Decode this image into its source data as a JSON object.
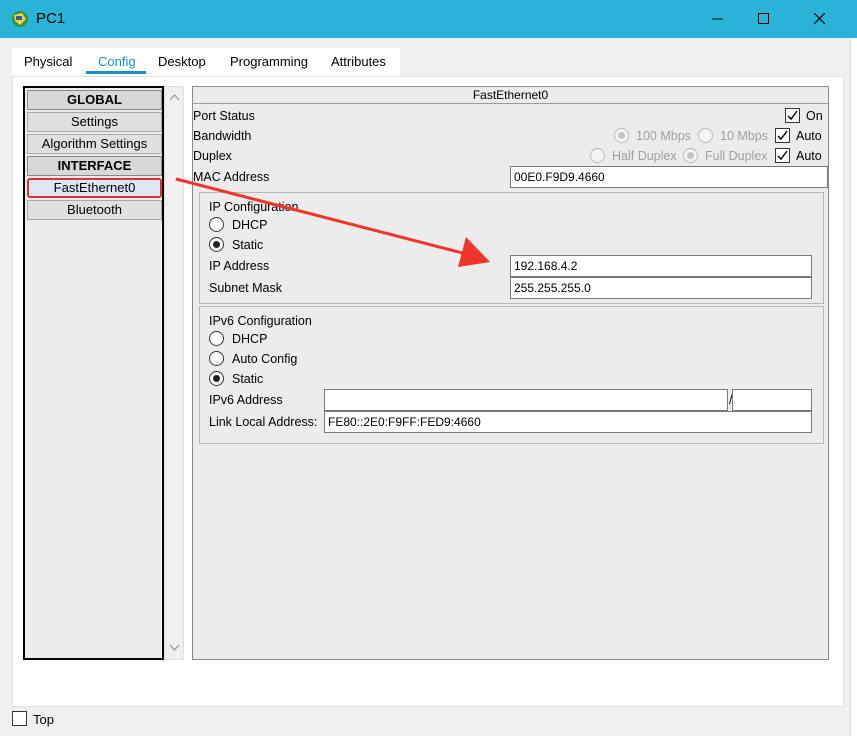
{
  "window": {
    "title": "PC1"
  },
  "tabs": [
    "Physical",
    "Config",
    "Desktop",
    "Programming",
    "Attributes"
  ],
  "active_tab": "Config",
  "left_nav": {
    "items": [
      {
        "label": "GLOBAL",
        "type": "header"
      },
      {
        "label": "Settings",
        "type": "item"
      },
      {
        "label": "Algorithm Settings",
        "type": "item"
      },
      {
        "label": "INTERFACE",
        "type": "header"
      },
      {
        "label": "FastEthernet0",
        "type": "item",
        "selected": true
      },
      {
        "label": "Bluetooth",
        "type": "item"
      }
    ]
  },
  "panel": {
    "title": "FastEthernet0",
    "port_status": {
      "label": "Port Status",
      "on_label": "On",
      "on_checked": true
    },
    "bandwidth": {
      "label": "Bandwidth",
      "opt1": "100 Mbps",
      "opt2": "10 Mbps",
      "auto_label": "Auto",
      "auto_checked": true
    },
    "duplex": {
      "label": "Duplex",
      "opt1": "Half Duplex",
      "opt2": "Full Duplex",
      "auto_label": "Auto",
      "auto_checked": true
    },
    "mac": {
      "label": "MAC Address",
      "value": "00E0.F9D9.4660"
    },
    "ip_config": {
      "title": "IP Configuration",
      "dhcp_label": "DHCP",
      "static_label": "Static",
      "selected": "Static",
      "ip_label": "IP Address",
      "ip_value": "192.168.4.2",
      "mask_label": "Subnet Mask",
      "mask_value": "255.255.255.0"
    },
    "ipv6_config": {
      "title": "IPv6 Configuration",
      "dhcp_label": "DHCP",
      "auto_label": "Auto Config",
      "static_label": "Static",
      "selected": "Static",
      "addr_label": "IPv6 Address",
      "addr_value": "",
      "prefix_sep": "/",
      "prefix_value": "",
      "link_local_label": "Link Local Address:",
      "link_local_value": "FE80::2E0:F9FF:FED9:4660"
    }
  },
  "footer": {
    "top_label": "Top",
    "top_checked": false
  },
  "colors": {
    "titlebar": "#29b3d6",
    "accent": "#1a8fc7",
    "highlight": "#e03030"
  }
}
